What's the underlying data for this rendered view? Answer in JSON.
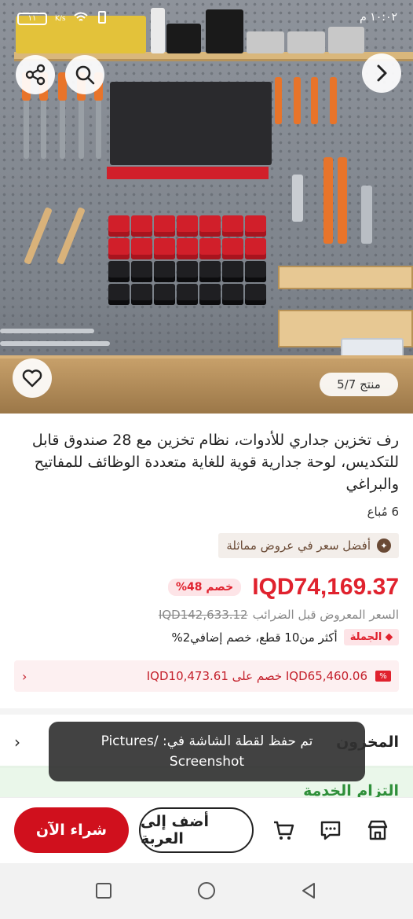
{
  "status_bar": {
    "time": "١٠:٠٢ م",
    "battery": "١١",
    "network": "K/s"
  },
  "gallery": {
    "counter": "منتج 5/7"
  },
  "product": {
    "title": "رف تخزين جداري للأدوات، نظام تخزين مع 28 صندوق قابل للتكديس، لوحة جدارية قوية للغاية متعددة الوظائف للمفاتيح والبراغي",
    "sold": "6 مُباع",
    "best_price": "أفضل سعر في عروض مماثلة",
    "price": "IQD74,169.37",
    "discount": "خصم 48%",
    "original_price": "IQD142,633.12",
    "original_label": "السعر المعروض قبل الضرائب",
    "bulk_badge": "الجملة",
    "bulk_text": "أكثر من10 قطع، خصم إضافي2%",
    "coupon_text": "IQD65,460.06 خصم على IQD10,473.61",
    "stock_label": "المخزون",
    "service_label": "التزام الخدمة"
  },
  "toast": {
    "line1": "تم حفظ لقطة الشاشة في: /Pictures",
    "line2": "Screenshot"
  },
  "actions": {
    "buy_now": "شراء الآن",
    "add_to_cart": "أضف إلى العربة"
  },
  "colors": {
    "accent": "#d0101d",
    "price": "#e0222e"
  }
}
